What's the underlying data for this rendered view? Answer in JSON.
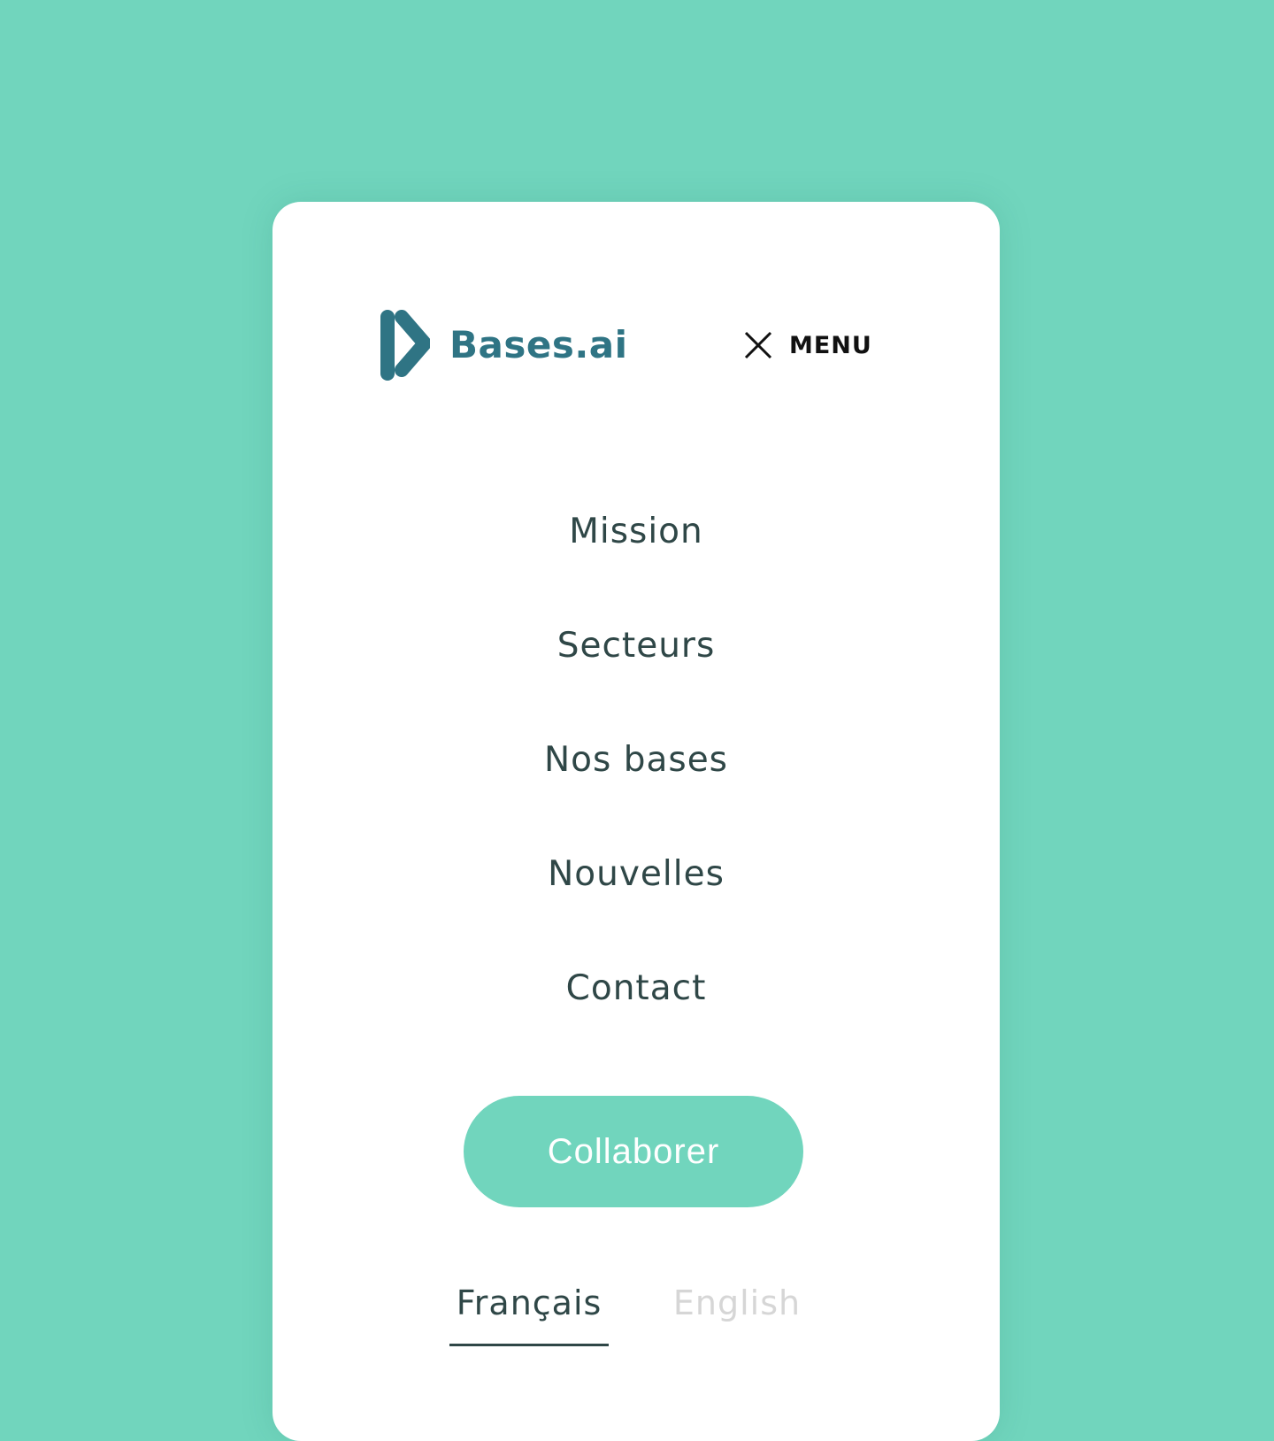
{
  "brand": {
    "name": "Bases.ai",
    "color": "#2f7484"
  },
  "header": {
    "menu_label": "MENU",
    "menu_icon": "close-icon"
  },
  "nav": {
    "items": [
      {
        "label": "Mission"
      },
      {
        "label": "Secteurs"
      },
      {
        "label": "Nos bases"
      },
      {
        "label": "Nouvelles"
      },
      {
        "label": "Contact"
      }
    ]
  },
  "cta": {
    "label": "Collaborer",
    "color": "#71d5bd"
  },
  "languages": {
    "items": [
      {
        "label": "Français",
        "active": true
      },
      {
        "label": "English",
        "active": false
      }
    ]
  },
  "colors": {
    "background": "#71d5bd",
    "card": "#ffffff",
    "text": "#2f4747",
    "inactive_text": "#d6d6d6"
  }
}
